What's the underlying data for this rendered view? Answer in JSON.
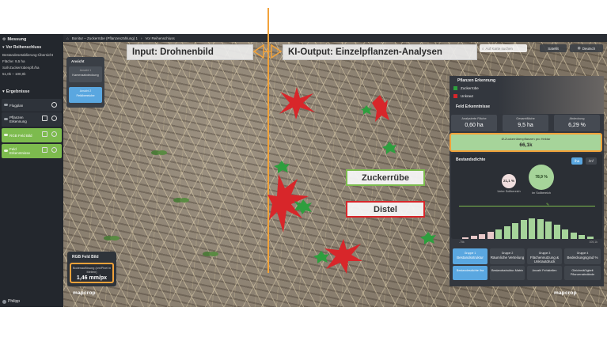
{
  "sidebar": {
    "section_measure": "Messung",
    "subsection": "Vor Reihenschluss",
    "rows": [
      "Bestandesetablierung-Übersicht",
      "Fläche: 9,5 ha",
      "Soll-Zuckerrübenpfl./ha",
      "51,0k – 100,0k"
    ],
    "results_title": "Ergebnisse",
    "items": [
      {
        "label": "Flugplan"
      },
      {
        "label": "Pflanzen Erkennung"
      },
      {
        "label": "RGB Feld Bild"
      },
      {
        "label": "Feld Erkenntnisse"
      }
    ],
    "user": "Philipp"
  },
  "topbar": {
    "crumbs": [
      "Bonitur – Zuckerrübe (Pflanzenzählung) 1",
      "Vor Reihenschluss"
    ]
  },
  "banners": {
    "left": "Input: Drohnenbild",
    "right": "KI-Output: Einzelpflanzen-Analysen"
  },
  "labels": {
    "sugarbeet": "Zuckerrübe",
    "thistle": "Distel"
  },
  "view_card": {
    "title": "Ansicht",
    "btn1_small": "Ansicht 1",
    "btn1": "Kameraabdeckung",
    "btn2_small": "Ansicht 2",
    "btn2": "Feldbereiche"
  },
  "search": {
    "placeholder": "Auf Karte suchen"
  },
  "toolbar": {
    "satellite": "Satellit",
    "language": "Deutsch"
  },
  "rgb_card": {
    "title": "RGB Feld Bild",
    "box_label": "Bodenauflösung (cm/Pixel in Metern)",
    "value": "1,46 mm/px"
  },
  "panel": {
    "title": "Pflanzen Erkennung",
    "legend": [
      {
        "label": "Zuckerrübe",
        "color": "#2e9e3e"
      },
      {
        "label": "Unkraut",
        "color": "#d8262a"
      }
    ],
    "insights_title": "Feld Erkenntnisse",
    "stats": [
      {
        "label": "Analysierte Fläche",
        "value": "0,60 ha"
      },
      {
        "label": "Gesamtfläche",
        "value": "9,5 ha"
      },
      {
        "label": "Abdeckung",
        "value": "6,29 %"
      }
    ],
    "kpi_label": "Ø-Zuckerrübenpflanzen pro Hektar",
    "kpi_value": "66,1k",
    "density_title": "Bestandsdichte",
    "unit_ha": "/ha",
    "unit_m2": "/m²",
    "under": {
      "value": "21,1 %",
      "label": "Unter Sollbereich"
    },
    "in": {
      "value": "78,9 %",
      "label": "Im Sollbereich"
    },
    "hist_min": "-75k",
    "hist_max": "105,1k",
    "tiles": [
      {
        "small": "Gruppe 1",
        "label": "Bestandsstruktur"
      },
      {
        "small": "Gruppe 2",
        "label": "Räumliche Verteilung"
      },
      {
        "small": "Gruppe 3",
        "label": "Flächennutzung & Unkrautdruck"
      },
      {
        "small": "Gruppe 4",
        "label": "Bedeckungsgrad %"
      }
    ],
    "tiles2": [
      "Bestandesdichte /ha",
      "Bestandsstruktur-Matrix",
      "Anzahl Fehlstellen",
      "Gleichmäßigkeit Pflanzenabstände"
    ]
  },
  "logos": {
    "left": "mapcrop",
    "right": "mapcrop"
  }
}
